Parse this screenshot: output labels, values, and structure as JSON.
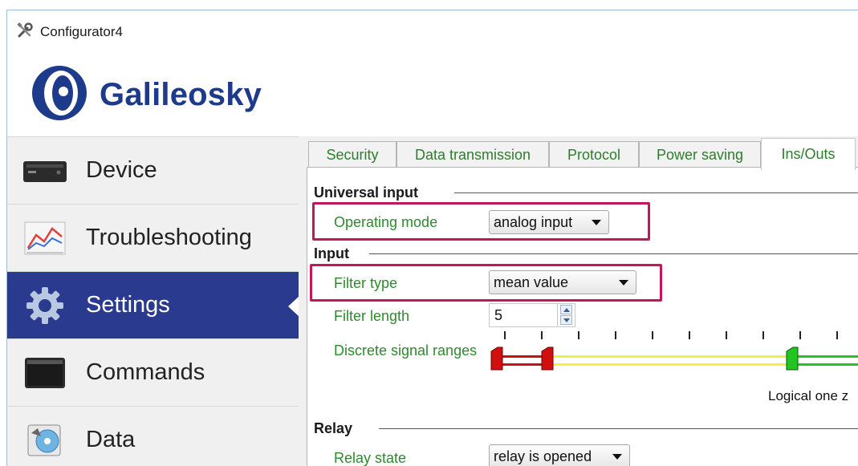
{
  "window": {
    "title": "Configurator4",
    "app_icon": "tools-icon"
  },
  "logo": {
    "text": "Galileosky",
    "colors": {
      "brand_blue": "#1e3a8a"
    }
  },
  "sidebar": {
    "items": [
      {
        "label": "Device",
        "icon": "device-icon"
      },
      {
        "label": "Troubleshooting",
        "icon": "chart-icon"
      },
      {
        "label": "Settings",
        "icon": "gear-icon",
        "active": true
      },
      {
        "label": "Commands",
        "icon": "terminal-icon"
      },
      {
        "label": "Data",
        "icon": "disk-icon"
      }
    ],
    "colors": {
      "active_bg": "#2a3a8f"
    }
  },
  "tabs": [
    {
      "label": "Security"
    },
    {
      "label": "Data transmission"
    },
    {
      "label": "Protocol"
    },
    {
      "label": "Power saving"
    },
    {
      "label": "Ins/Outs",
      "active": true
    }
  ],
  "universal_input": {
    "heading": "Universal input",
    "operating_mode": {
      "label": "Operating mode",
      "value": "analog input"
    }
  },
  "input": {
    "heading": "Input",
    "filter_type": {
      "label": "Filter type",
      "value": "mean value"
    },
    "filter_length": {
      "label": "Filter length",
      "value": "5"
    },
    "discrete_signal_ranges": {
      "label": "Discrete signal ranges",
      "caption": "Logical one z",
      "colors": {
        "logical_zero": "#d01010",
        "transition": "#f2f23a",
        "logical_one": "#22c422"
      }
    }
  },
  "relay": {
    "heading": "Relay",
    "relay_state": {
      "label": "Relay state",
      "value": "relay is opened"
    }
  },
  "colors": {
    "highlight": "#c2185b",
    "label_green": "#2d8a2d"
  }
}
